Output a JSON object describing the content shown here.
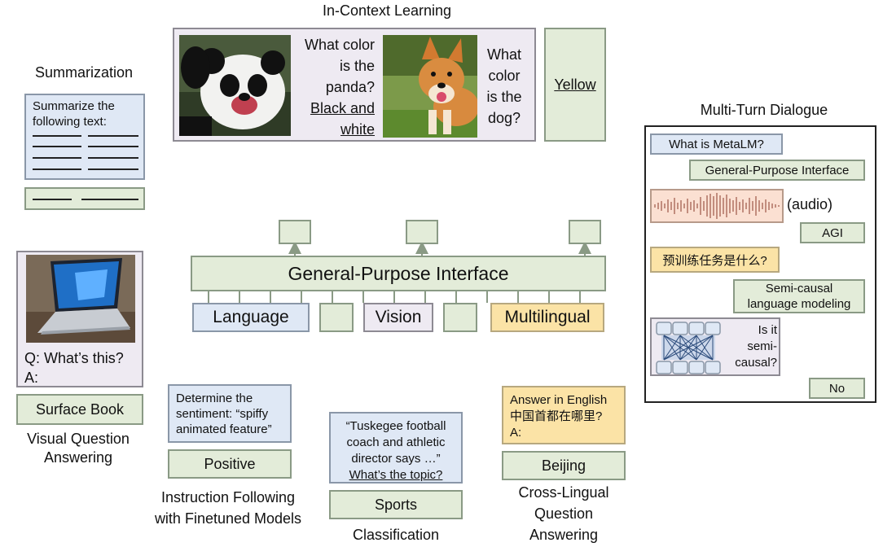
{
  "icl": {
    "title": "In-Context Learning",
    "q1": [
      "What color",
      "is the",
      "panda?"
    ],
    "a1": [
      "Black and",
      "white"
    ],
    "q2": [
      "What",
      "color",
      "is the",
      "dog?"
    ],
    "answer": "Yellow"
  },
  "summarization": {
    "title": "Summarization",
    "prompt": [
      "Summarize the",
      "following text:"
    ]
  },
  "vqa": {
    "q": "Q: What’s this?",
    "a": "A:",
    "answer": "Surface Book",
    "caption": [
      "Visual Question",
      "Answering"
    ]
  },
  "interface": {
    "title": "General-Purpose Interface",
    "inputs": [
      "Language",
      "Vision",
      "Multilingual"
    ]
  },
  "instruction": {
    "prompt": [
      "Determine the",
      "sentiment: “spiffy",
      "animated feature”"
    ],
    "answer": "Positive",
    "caption": [
      "Instruction Following",
      "with Finetuned Models"
    ]
  },
  "classification": {
    "prompt": [
      "“Tuskegee football",
      "coach and athletic",
      "director says …”"
    ],
    "question": "What’s the topic?",
    "answer": "Sports",
    "caption": "Classification"
  },
  "crosslingual": {
    "prompt": [
      "Answer in English",
      "中国首都在哪里?",
      "A:"
    ],
    "answer": "Beijing",
    "caption": [
      "Cross-Lingual",
      "Question",
      "Answering"
    ]
  },
  "dialogue": {
    "title": "Multi-Turn Dialogue",
    "q1": "What is MetaLM?",
    "a1": "General-Purpose Interface",
    "audio_label": "(audio)",
    "a2": "AGI",
    "q3": "预训练任务是什么?",
    "a3": [
      "Semi-causal",
      "language modeling"
    ],
    "q4": [
      "Is it",
      "semi-",
      "causal?"
    ],
    "a4": "No"
  },
  "colors": {
    "blue": "#dfe8f5",
    "green": "#e3ecd9",
    "yellow": "#fbe3a6",
    "lavender": "#eeeaf2"
  }
}
